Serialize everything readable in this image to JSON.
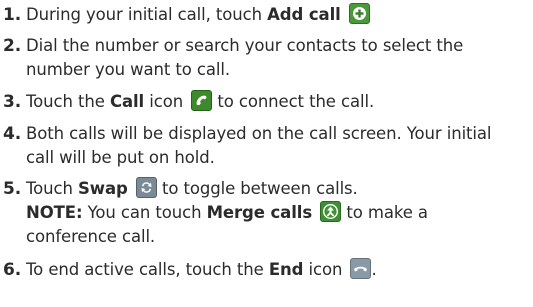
{
  "steps": [
    {
      "number": "1.",
      "text1": "During your initial call, touch ",
      "bold1": "Add call",
      "icon": "add-call-icon"
    },
    {
      "number": "2.",
      "line1": "Dial the number or search your contacts to select the",
      "line2": "number you want to call."
    },
    {
      "number": "3.",
      "text1": "Touch the ",
      "bold1": "Call",
      "text2": " icon ",
      "icon": "call-icon",
      "text3": " to connect the call."
    },
    {
      "number": "4.",
      "line1": "Both calls will be displayed on the call screen. Your initial",
      "line2": "call will be put on hold."
    },
    {
      "number": "5.",
      "text1": "Touch ",
      "bold1": "Swap",
      "icon": "swap-icon",
      "text2": " to toggle between calls.",
      "note_label": "NOTE:",
      "note_text1": " You can touch ",
      "note_bold": "Merge calls",
      "note_icon": "merge-calls-icon",
      "note_text2": " to make a",
      "note_line2": "conference call."
    },
    {
      "number": "6.",
      "text1": "To end active calls, touch the ",
      "bold1": "End",
      "text2": " icon ",
      "icon": "end-call-icon",
      "text3": "."
    }
  ]
}
